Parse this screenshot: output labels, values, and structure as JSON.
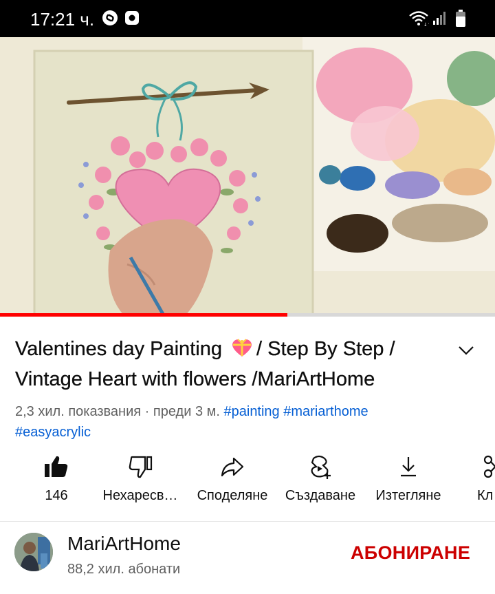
{
  "status_bar": {
    "time": "17:21 ч.",
    "icons": [
      "shazam-icon",
      "record-icon",
      "wifi-icon",
      "signal-icon",
      "battery-icon"
    ]
  },
  "video": {
    "progress": 0.58,
    "colors": {
      "progress": "#ff0000",
      "track": "#d8d8d8"
    }
  },
  "title": {
    "part1": "Valentines day Painting",
    "emoji": "sparkling-heart-gift-icon",
    "part2": "/  Step By Step / Vintage Heart with flowers /MariArtHome"
  },
  "meta": {
    "views": "2,3 хил. показвания",
    "separator": "·",
    "age": "преди 3 м.",
    "hashtags": [
      "#painting",
      "#mariarthome",
      "#easyacrylic"
    ]
  },
  "actions": [
    {
      "icon": "like-icon",
      "label": "146"
    },
    {
      "icon": "dislike-icon",
      "label": "Нехаресв…"
    },
    {
      "icon": "share-icon",
      "label": "Споделяне"
    },
    {
      "icon": "create-icon",
      "label": "Създаване"
    },
    {
      "icon": "download-icon",
      "label": "Изтегляне"
    },
    {
      "icon": "clip-icon",
      "label": "Кл"
    }
  ],
  "channel": {
    "name": "MariArtHome",
    "subscribers": "88,2 хил. абонати",
    "subscribe_label": "АБОНИРАНЕ"
  },
  "colors": {
    "accent": "#cc0000",
    "link": "#065fd4",
    "text": "#0f0f0f",
    "secondary": "#606060"
  }
}
